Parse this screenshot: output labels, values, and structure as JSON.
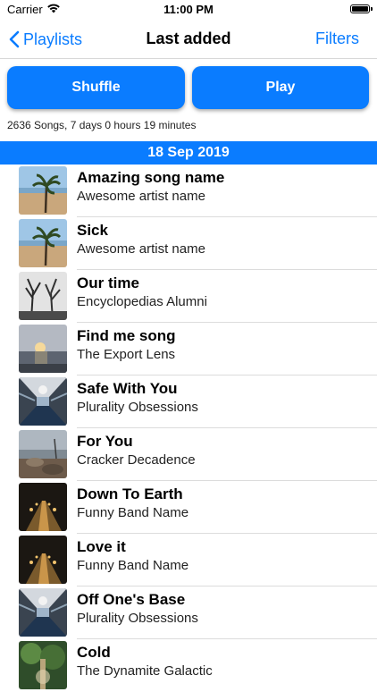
{
  "status_bar": {
    "carrier": "Carrier",
    "time": "11:00 PM"
  },
  "nav": {
    "back_label": "Playlists",
    "title": "Last added",
    "filters_label": "Filters"
  },
  "actions": {
    "shuffle_label": "Shuffle",
    "play_label": "Play"
  },
  "summary": "2636 Songs, 7 days 0 hours 19 minutes",
  "section_header": "18 Sep 2019",
  "songs": [
    {
      "title": "Amazing song name",
      "artist": "Awesome artist name",
      "art": "beach-palm"
    },
    {
      "title": "Sick",
      "artist": "Awesome artist name",
      "art": "beach-palm"
    },
    {
      "title": "Our time",
      "artist": "Encyclopedias Alumni",
      "art": "bare-trees"
    },
    {
      "title": "Find me song",
      "artist": "The Export Lens",
      "art": "sunset-sea"
    },
    {
      "title": "Safe With You",
      "artist": "Plurality Obsessions",
      "art": "subway-station"
    },
    {
      "title": "For You",
      "artist": "Cracker Decadence",
      "art": "rocky-shore"
    },
    {
      "title": "Down To Earth",
      "artist": "Funny Band Name",
      "art": "night-bridge"
    },
    {
      "title": "Love it",
      "artist": "Funny Band Name",
      "art": "night-bridge"
    },
    {
      "title": "Off One's Base",
      "artist": "Plurality Obsessions",
      "art": "subway-station"
    },
    {
      "title": "Cold",
      "artist": "The Dynamite Galactic",
      "art": "green-forest"
    }
  ],
  "colors": {
    "accent": "#0a7cff"
  }
}
